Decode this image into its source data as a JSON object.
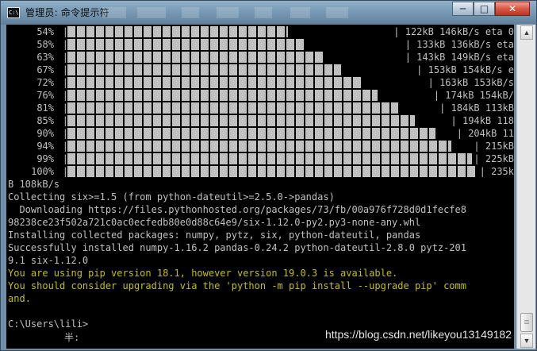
{
  "window": {
    "title": "管理员: 命令提示符",
    "icon_text": "C:\\",
    "controls": {
      "minimize": "─",
      "maximize": "□",
      "close": "✕"
    }
  },
  "terminal": {
    "progress_rows": [
      {
        "pct": "54%",
        "stats": "| 122kB 146kB/s eta 0",
        "fill": 0.54
      },
      {
        "pct": "58%",
        "stats": "| 133kB 136kB/s eta",
        "fill": 0.58
      },
      {
        "pct": "63%",
        "stats": "| 143kB 149kB/s eta",
        "fill": 0.63
      },
      {
        "pct": "67%",
        "stats": "| 153kB 154kB/s e",
        "fill": 0.67
      },
      {
        "pct": "72%",
        "stats": "| 163kB 153kB/s",
        "fill": 0.72
      },
      {
        "pct": "76%",
        "stats": "| 174kB 154kB/",
        "fill": 0.76
      },
      {
        "pct": "81%",
        "stats": "| 184kB 113kB",
        "fill": 0.81
      },
      {
        "pct": "85%",
        "stats": "| 194kB 118",
        "fill": 0.85
      },
      {
        "pct": "90%",
        "stats": "| 204kB 11",
        "fill": 0.9
      },
      {
        "pct": "94%",
        "stats": "| 215kB",
        "fill": 0.94
      },
      {
        "pct": "99%",
        "stats": "| 225kB",
        "fill": 0.99
      },
      {
        "pct": "100%",
        "stats": "| 235k",
        "fill": 1.0
      }
    ],
    "lines": [
      {
        "text": "B 108kB/s",
        "color": "default"
      },
      {
        "text": "Collecting six>=1.5 (from python-dateutil>=2.5.0->pandas)",
        "color": "default"
      },
      {
        "text": "  Downloading https://files.pythonhosted.org/packages/73/fb/00a976f728d0d1fecfe8",
        "color": "default"
      },
      {
        "text": "98238ce23f502a721c0ac0ecfedb80e0d88c64e9/six-1.12.0-py2.py3-none-any.whl",
        "color": "default"
      },
      {
        "text": "Installing collected packages: numpy, pytz, six, python-dateutil, pandas",
        "color": "default"
      },
      {
        "text": "Successfully installed numpy-1.16.2 pandas-0.24.2 python-dateutil-2.8.0 pytz-201",
        "color": "default"
      },
      {
        "text": "9.1 six-1.12.0",
        "color": "default"
      },
      {
        "text": "You are using pip version 18.1, however version 19.0.3 is available.",
        "color": "yellow"
      },
      {
        "text": "You should consider upgrading via the 'python -m pip install --upgrade pip' comm",
        "color": "yellow"
      },
      {
        "text": "and.",
        "color": "yellow"
      },
      {
        "text": "",
        "color": "default"
      },
      {
        "text": "C:\\Users\\lili>",
        "color": "default"
      }
    ],
    "ime_text": "半:"
  },
  "watermark": "https://blog.csdn.net/likeyou13149182",
  "colors": {
    "terminal_bg": "#000000",
    "terminal_fg": "#c0c0c0",
    "warning_fg": "#c2c200",
    "titlebar": "#7596b0"
  },
  "scrollbar": {
    "up_icon": "▲",
    "down_icon": "▼"
  }
}
